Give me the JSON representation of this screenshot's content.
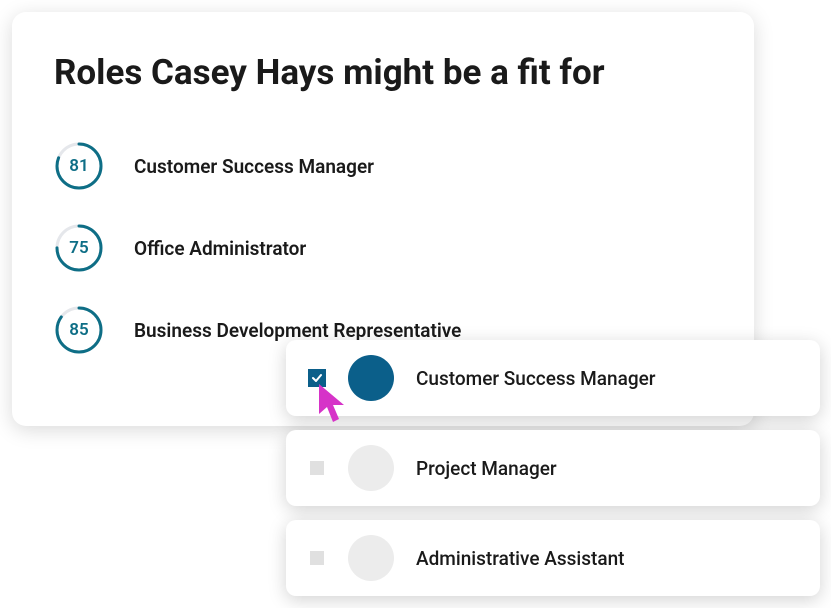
{
  "header": {
    "title": "Roles Casey Hays might be a fit for"
  },
  "roles": [
    {
      "score": 81,
      "label": "Customer Success Manager"
    },
    {
      "score": 75,
      "label": "Office Administrator"
    },
    {
      "score": 85,
      "label": "Business Development Representative"
    }
  ],
  "selections": [
    {
      "label": "Customer Success Manager",
      "checked": true,
      "avatar": "active"
    },
    {
      "label": "Project Manager",
      "checked": false,
      "avatar": "placeholder"
    },
    {
      "label": "Administrative Assistant",
      "checked": false,
      "avatar": "placeholder"
    }
  ],
  "colors": {
    "accent": "#0b5f8a",
    "teal": "#0e6e86"
  }
}
